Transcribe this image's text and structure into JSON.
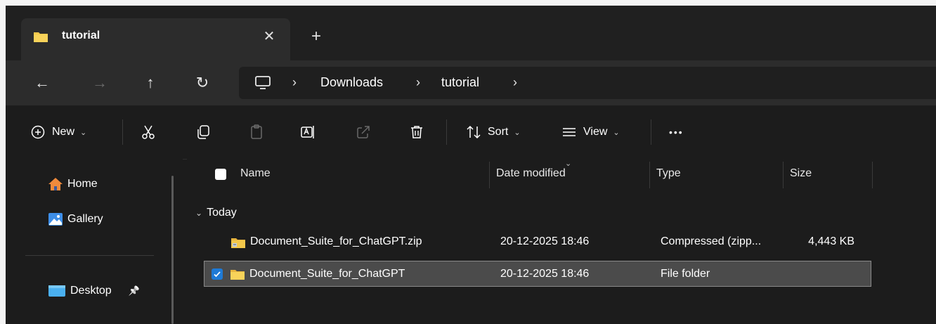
{
  "tab": {
    "title": "tutorial",
    "close_glyph": "✕",
    "new_tab_glyph": "+"
  },
  "nav": {
    "back_glyph": "←",
    "forward_glyph": "→",
    "up_glyph": "↑",
    "refresh_glyph": "↻",
    "breadcrumb": [
      "Downloads",
      "tutorial"
    ],
    "separator": "›"
  },
  "commands": {
    "new_label": "New",
    "sort_label": "Sort",
    "view_label": "View",
    "more_glyph": "•••",
    "chevron": "⌄"
  },
  "sidebar": {
    "items": [
      {
        "label": "Home",
        "icon": "home-icon"
      },
      {
        "label": "Gallery",
        "icon": "gallery-icon"
      },
      {
        "label": "Desktop",
        "icon": "desktop-folder-icon",
        "pinned": true
      }
    ],
    "pin_glyph": "📌"
  },
  "columns": {
    "name": "Name",
    "date_modified": "Date modified",
    "type": "Type",
    "size": "Size"
  },
  "group": {
    "label": "Today",
    "caret": "⌄"
  },
  "files": [
    {
      "name": "Document_Suite_for_ChatGPT.zip",
      "date": "20-12-2025 18:46",
      "type": "Compressed (zipp...",
      "size": "4,443 KB",
      "icon": "zip-folder-icon",
      "selected": false
    },
    {
      "name": "Document_Suite_for_ChatGPT",
      "date": "20-12-2025 18:46",
      "type": "File folder",
      "size": "",
      "icon": "folder-icon",
      "selected": true
    }
  ],
  "colors": {
    "window_bg": "#1c1c1c",
    "folder_yellow": "#f3c84b",
    "accent_blue": "#1e7ad6",
    "selection_bg": "#4b4b4b"
  }
}
